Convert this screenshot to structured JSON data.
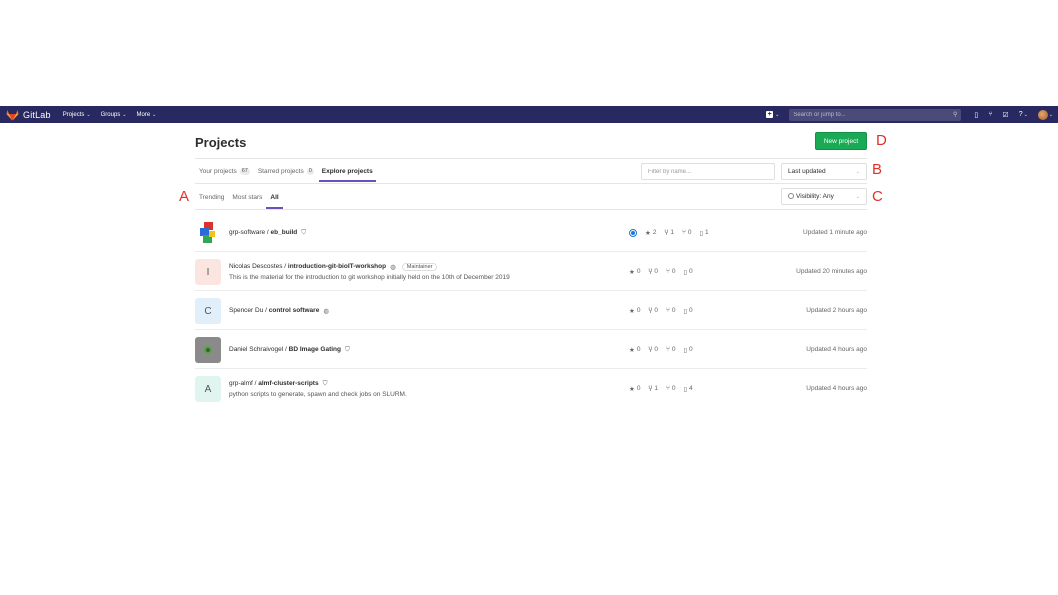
{
  "navbar": {
    "app_name": "GitLab",
    "menu": [
      "Projects",
      "Groups",
      "More"
    ],
    "search_placeholder": "Search or jump to...",
    "brand_color": "#292961"
  },
  "page": {
    "title": "Projects",
    "new_project_label": "New project"
  },
  "tabs": [
    {
      "label": "Your projects",
      "count": "67"
    },
    {
      "label": "Starred projects",
      "count": "0"
    },
    {
      "label": "Explore projects",
      "count": ""
    }
  ],
  "filter_placeholder": "Filter by name...",
  "sort_label": "Last updated",
  "visibility_label": "Visibility: Any",
  "subtabs": [
    "Trending",
    "Most stars",
    "All"
  ],
  "markers": {
    "a": "A",
    "b": "B",
    "c": "C",
    "d": "D"
  },
  "projects": [
    {
      "namespace": "grp-software / ",
      "name": "eb_build",
      "visibility_icon": "lock-icon",
      "role": "",
      "description": "",
      "avatar_letter": "",
      "stars": "2",
      "forks": "1",
      "mrs": "0",
      "issues": "1",
      "updated": "Updated 1 minute ago"
    },
    {
      "namespace": "Nicolas Descostes / ",
      "name": "introduction-git-bioIT-workshop",
      "visibility_icon": "globe-icon",
      "role": "Maintainer",
      "description": "This is the material for the introduction to git workshop initially held on the 10th of December 2019",
      "avatar_letter": "I",
      "stars": "0",
      "forks": "0",
      "mrs": "0",
      "issues": "0",
      "updated": "Updated 20 minutes ago"
    },
    {
      "namespace": "Spencer Du / ",
      "name": "control software",
      "visibility_icon": "globe-icon",
      "role": "",
      "description": "",
      "avatar_letter": "C",
      "stars": "0",
      "forks": "0",
      "mrs": "0",
      "issues": "0",
      "updated": "Updated 2 hours ago"
    },
    {
      "namespace": "Daniel Schraivogel / ",
      "name": "BD Image Gating",
      "visibility_icon": "lock-icon",
      "role": "",
      "description": "",
      "avatar_letter": "",
      "stars": "0",
      "forks": "0",
      "mrs": "0",
      "issues": "0",
      "updated": "Updated 4 hours ago"
    },
    {
      "namespace": "grp-almf / ",
      "name": "almf-cluster-scripts",
      "visibility_icon": "lock-icon",
      "role": "",
      "description": "python scripts to generate, spawn and check jobs on SLURM.",
      "avatar_letter": "A",
      "stars": "0",
      "forks": "1",
      "mrs": "0",
      "issues": "4",
      "updated": "Updated 4 hours ago"
    }
  ]
}
